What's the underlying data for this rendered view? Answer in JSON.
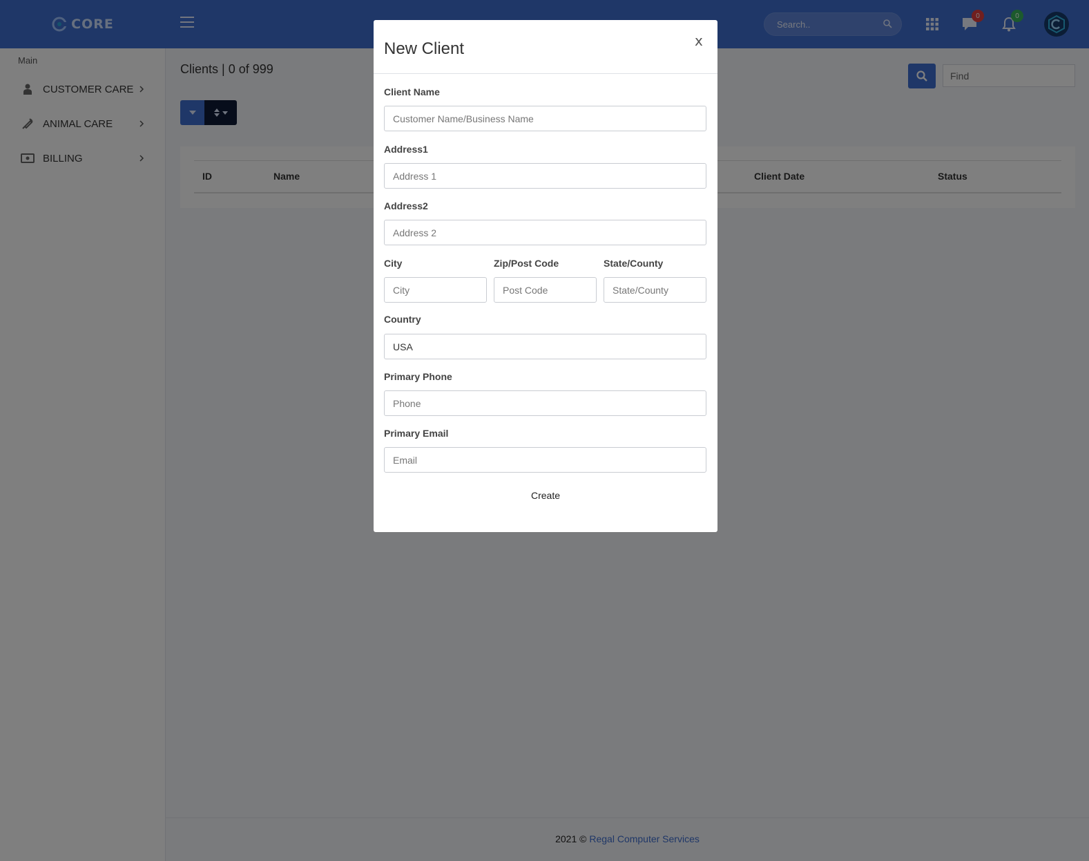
{
  "header": {
    "logo_text": "CORE",
    "search_placeholder": "Search..",
    "messages_count": "0",
    "notifications_count": "0"
  },
  "sidebar": {
    "heading": "Main",
    "items": [
      {
        "label": "CUSTOMER CARE",
        "icon": "person-icon"
      },
      {
        "label": "ANIMAL CARE",
        "icon": "syringe-icon"
      },
      {
        "label": "BILLING",
        "icon": "money-icon"
      }
    ]
  },
  "main": {
    "title": "Clients | 0 of 999",
    "find_placeholder": "Find",
    "table": {
      "columns": [
        "ID",
        "Name",
        "Client Date",
        "Status"
      ]
    }
  },
  "footer": {
    "prefix": "2021 © ",
    "link": "Regal Computer Services"
  },
  "modal": {
    "title": "New Client",
    "close": "x",
    "fields": {
      "client_name": {
        "label": "Client Name",
        "placeholder": "Customer Name/Business Name",
        "value": ""
      },
      "address1": {
        "label": "Address1",
        "placeholder": "Address 1",
        "value": ""
      },
      "address2": {
        "label": "Address2",
        "placeholder": "Address 2",
        "value": ""
      },
      "city": {
        "label": "City",
        "placeholder": "City",
        "value": ""
      },
      "zip": {
        "label": "Zip/Post Code",
        "placeholder": "Post Code",
        "value": ""
      },
      "state": {
        "label": "State/County",
        "placeholder": "State/County",
        "value": ""
      },
      "country": {
        "label": "Country",
        "placeholder": "",
        "value": "USA"
      },
      "phone": {
        "label": "Primary Phone",
        "placeholder": "Phone",
        "value": ""
      },
      "email": {
        "label": "Primary Email",
        "placeholder": "Email",
        "value": ""
      }
    },
    "create_label": "Create"
  },
  "colors": {
    "primary": "#3f6fd0",
    "dark_button": "#0e1a36",
    "badge_red": "#e33e3e",
    "badge_green": "#38b45b"
  }
}
